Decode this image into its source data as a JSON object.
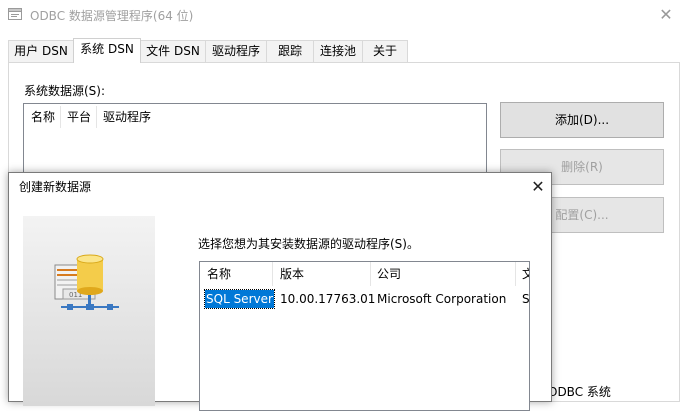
{
  "window": {
    "title": "ODBC 数据源管理程序(64 位)",
    "close_glyph": "✕"
  },
  "tabs": [
    {
      "label": "用户 DSN",
      "active": false
    },
    {
      "label": "系统 DSN",
      "active": true
    },
    {
      "label": "文件 DSN",
      "active": false
    },
    {
      "label": "驱动程序",
      "active": false
    },
    {
      "label": "跟踪",
      "active": false
    },
    {
      "label": "连接池",
      "active": false
    },
    {
      "label": "关于",
      "active": false
    }
  ],
  "system_dsn": {
    "list_label": "系统数据源(S):",
    "columns": [
      "名称",
      "平台",
      "驱动程序"
    ],
    "buttons": {
      "add": "添加(D)...",
      "remove": "删除(R)",
      "configure": "配置(C)..."
    },
    "partial_text": "ODBC 系统"
  },
  "dialog": {
    "title": "创建新数据源",
    "close_glyph": "✕",
    "instruction": "选择您想为其安装数据源的驱动程序(S)。",
    "columns": [
      "名称",
      "版本",
      "公司",
      "文"
    ],
    "rows": [
      {
        "name": "SQL Server",
        "version": "10.00.17763.01",
        "company": "Microsoft Corporation",
        "file": "S",
        "selected": true
      }
    ]
  },
  "icons": {
    "app": "odbc-window-icon",
    "dialog_image": "database-network-icon"
  },
  "colors": {
    "selection": "#0078d7",
    "disabled_text": "#a0a0a0",
    "button_face": "#e1e1e1"
  }
}
